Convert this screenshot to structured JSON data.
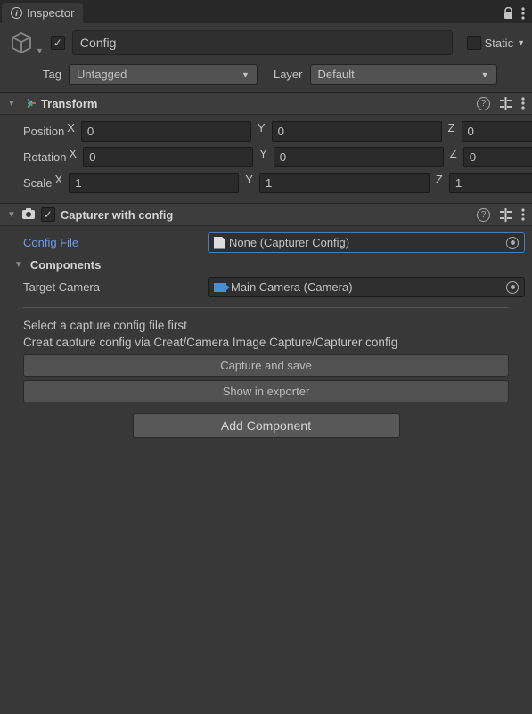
{
  "tab": {
    "title": "Inspector"
  },
  "header": {
    "name": "Config",
    "static_label": "Static",
    "tag_label": "Tag",
    "tag_value": "Untagged",
    "layer_label": "Layer",
    "layer_value": "Default"
  },
  "transform": {
    "title": "Transform",
    "position_label": "Position",
    "rotation_label": "Rotation",
    "scale_label": "Scale",
    "position": {
      "x": "0",
      "y": "0",
      "z": "0"
    },
    "rotation": {
      "x": "0",
      "y": "0",
      "z": "0"
    },
    "scale": {
      "x": "1",
      "y": "1",
      "z": "1"
    },
    "xl": "X",
    "yl": "Y",
    "zl": "Z"
  },
  "capturer": {
    "title": "Capturer with config",
    "config_file_label": "Config File",
    "config_file_value": "None (Capturer Config)",
    "components_label": "Components",
    "target_camera_label": "Target Camera",
    "target_camera_value": "Main Camera (Camera)",
    "info1": "Select a capture config file first",
    "info2": "Creat capture config via Creat/Camera Image Capture/Capturer config",
    "capture_btn": "Capture and save",
    "show_btn": "Show in exporter"
  },
  "add_component_label": "Add Component"
}
